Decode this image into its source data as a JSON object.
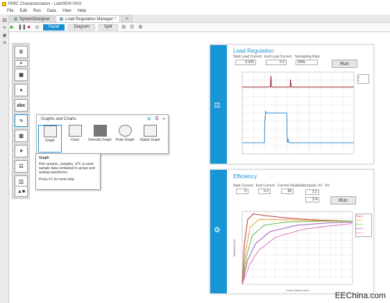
{
  "window": {
    "title": "PMIC Characterization - LabVIEW NXG"
  },
  "menu": [
    "File",
    "Edit",
    "Run",
    "Data",
    "View",
    "Help"
  ],
  "tabs": [
    {
      "label": "SystemDesigner"
    },
    {
      "label": "Load Regulation Manager *"
    },
    {
      "label": "+"
    }
  ],
  "views": {
    "panel": "Panel",
    "diagram": "Diagram",
    "split": "Split"
  },
  "flyout": {
    "title": "Graphs and Charts",
    "items": [
      "Graph",
      "Chart",
      "Intensity Graph",
      "Polar Graph",
      "Digital Graph"
    ]
  },
  "tooltip": {
    "title": "Graph",
    "body": "Plot numeric, complex, X/Y, or point sample data contained in arrays and analog waveforms.",
    "help": "Press F1 for more help"
  },
  "palette": {
    "badge": "abc"
  },
  "load_regulation": {
    "title": "Load Regulation",
    "start_label": "Start Load Current",
    "end_label": "End Load Current",
    "rate_label": "Samapling Rate",
    "start_value": "0.025",
    "end_value": "0.2",
    "rate_value": "500k",
    "run": "Run",
    "legend": [
      "y",
      "x"
    ]
  },
  "efficiency": {
    "title": "Efficiency",
    "start_label": "Start Current",
    "end_label": "End Current",
    "steps_label": "Current Steps",
    "vin_label": "Valid inputs: 3V - 5V",
    "start_value": "0",
    "end_value": "0.2",
    "steps_value": "50",
    "vin_value1": "3.2",
    "vin_value2": "3.4",
    "run": "Run",
    "legend": [
      "Plot 0",
      "Plot 1",
      "Plot 2",
      "Plot 3",
      "Plot 4"
    ],
    "xlabel": "Load Current (mA)",
    "ylabel": "Efficiency (%)"
  },
  "watermark": "EEChina.com",
  "colors": {
    "accent": "#1a8fd6",
    "trace": "#2a86d1"
  },
  "chart_data": [
    {
      "type": "line",
      "title": "Load Regulation",
      "series": [
        {
          "values": [
            [
              0,
              0.8
            ],
            [
              250,
              0.8
            ],
            [
              252,
              0.82
            ],
            [
              258,
              0.95
            ],
            [
              262,
              0.8
            ],
            [
              430,
              0.8
            ],
            [
              432,
              0.9
            ],
            [
              440,
              0.8
            ],
            [
              1000,
              0.8
            ]
          ]
        },
        {
          "values": [
            [
              0,
              0.05
            ],
            [
              200,
              0.05
            ],
            [
              201,
              0.3
            ],
            [
              210,
              0.47
            ],
            [
              220,
              0.45
            ],
            [
              400,
              0.45
            ],
            [
              401,
              0.2
            ],
            [
              405,
              0.05
            ],
            [
              410,
              0.1
            ],
            [
              420,
              0.05
            ],
            [
              1000,
              0.05
            ]
          ]
        }
      ],
      "xlim": [
        0,
        1000
      ],
      "ylim": [
        -0.1,
        1
      ]
    },
    {
      "type": "line",
      "title": "Efficiency",
      "xlabel": "Load Current (mA)",
      "ylabel": "Efficiency (%)",
      "xlim": [
        0,
        200
      ],
      "ylim": [
        0,
        90
      ],
      "series": [
        {
          "name": "Plot 0",
          "values": [
            [
              0,
              0
            ],
            [
              4,
              50
            ],
            [
              10,
              80
            ],
            [
              20,
              87
            ],
            [
              40,
              85
            ],
            [
              80,
              82
            ],
            [
              120,
              80
            ],
            [
              200,
              78
            ]
          ]
        },
        {
          "name": "Plot 1",
          "values": [
            [
              0,
              0
            ],
            [
              6,
              40
            ],
            [
              14,
              70
            ],
            [
              30,
              80
            ],
            [
              60,
              80
            ],
            [
              120,
              79
            ],
            [
              200,
              78
            ]
          ]
        },
        {
          "name": "Plot 2",
          "values": [
            [
              0,
              0
            ],
            [
              8,
              35
            ],
            [
              18,
              60
            ],
            [
              40,
              73
            ],
            [
              80,
              77
            ],
            [
              140,
              78
            ],
            [
              200,
              78
            ]
          ]
        },
        {
          "name": "Plot 3",
          "values": [
            [
              0,
              0
            ],
            [
              10,
              30
            ],
            [
              24,
              50
            ],
            [
              50,
              65
            ],
            [
              100,
              73
            ],
            [
              160,
              76
            ],
            [
              200,
              77
            ]
          ]
        },
        {
          "name": "Plot 4",
          "values": [
            [
              0,
              0
            ],
            [
              14,
              25
            ],
            [
              30,
              42
            ],
            [
              60,
              58
            ],
            [
              110,
              68
            ],
            [
              170,
              73
            ],
            [
              200,
              75
            ]
          ]
        }
      ]
    }
  ]
}
